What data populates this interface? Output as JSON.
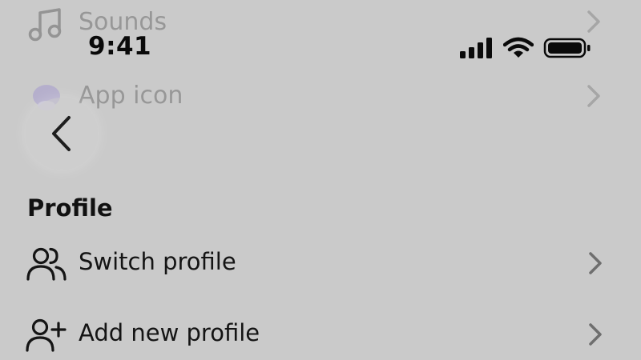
{
  "background_items": [
    {
      "label": "Sounds",
      "icon": "music-note-icon"
    },
    {
      "label": "App icon",
      "icon": "app-icon-avatar"
    }
  ],
  "status_bar": {
    "time": "9:41",
    "icons": [
      "cellular-signal-icon",
      "wifi-icon",
      "battery-icon"
    ]
  },
  "header": {
    "back_icon": "chevron-left-icon"
  },
  "profile_section": {
    "title": "Profile",
    "items": [
      {
        "label": "Switch profile",
        "icon": "people-icon"
      },
      {
        "label": "Add new profile",
        "icon": "person-add-icon"
      }
    ]
  },
  "colors": {
    "background": "#cacaca",
    "text": "#111111",
    "chevron": "#6e6e6e",
    "app_icon_accent": "#9b8cd4"
  }
}
